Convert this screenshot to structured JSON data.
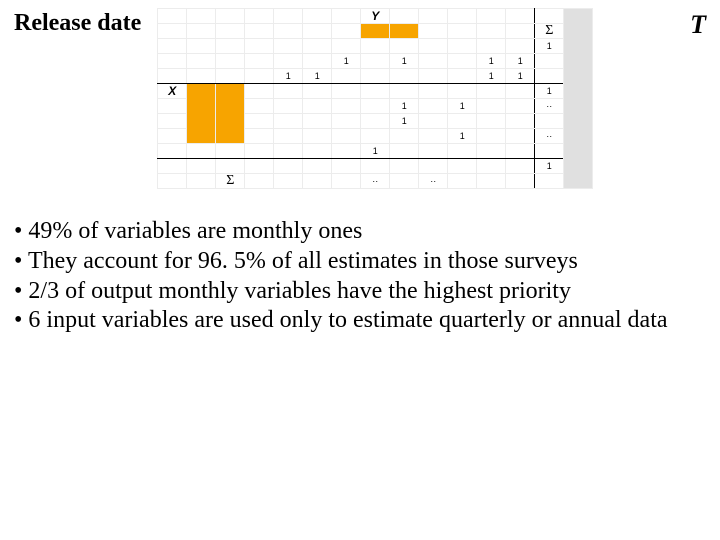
{
  "header": {
    "release_date": "Release date",
    "t_label": "T"
  },
  "grid": {
    "y_label": "Y",
    "x_label": "X",
    "sigma": "Σ",
    "one": "1",
    "dot": "·",
    "dots": "··"
  },
  "bullets": [
    "49% of variables are monthly ones",
    "They account for 96. 5% of all estimates in those surveys",
    "2/3 of output monthly variables have the highest priority",
    "6 input variables are used only to estimate quarterly or annual data"
  ]
}
